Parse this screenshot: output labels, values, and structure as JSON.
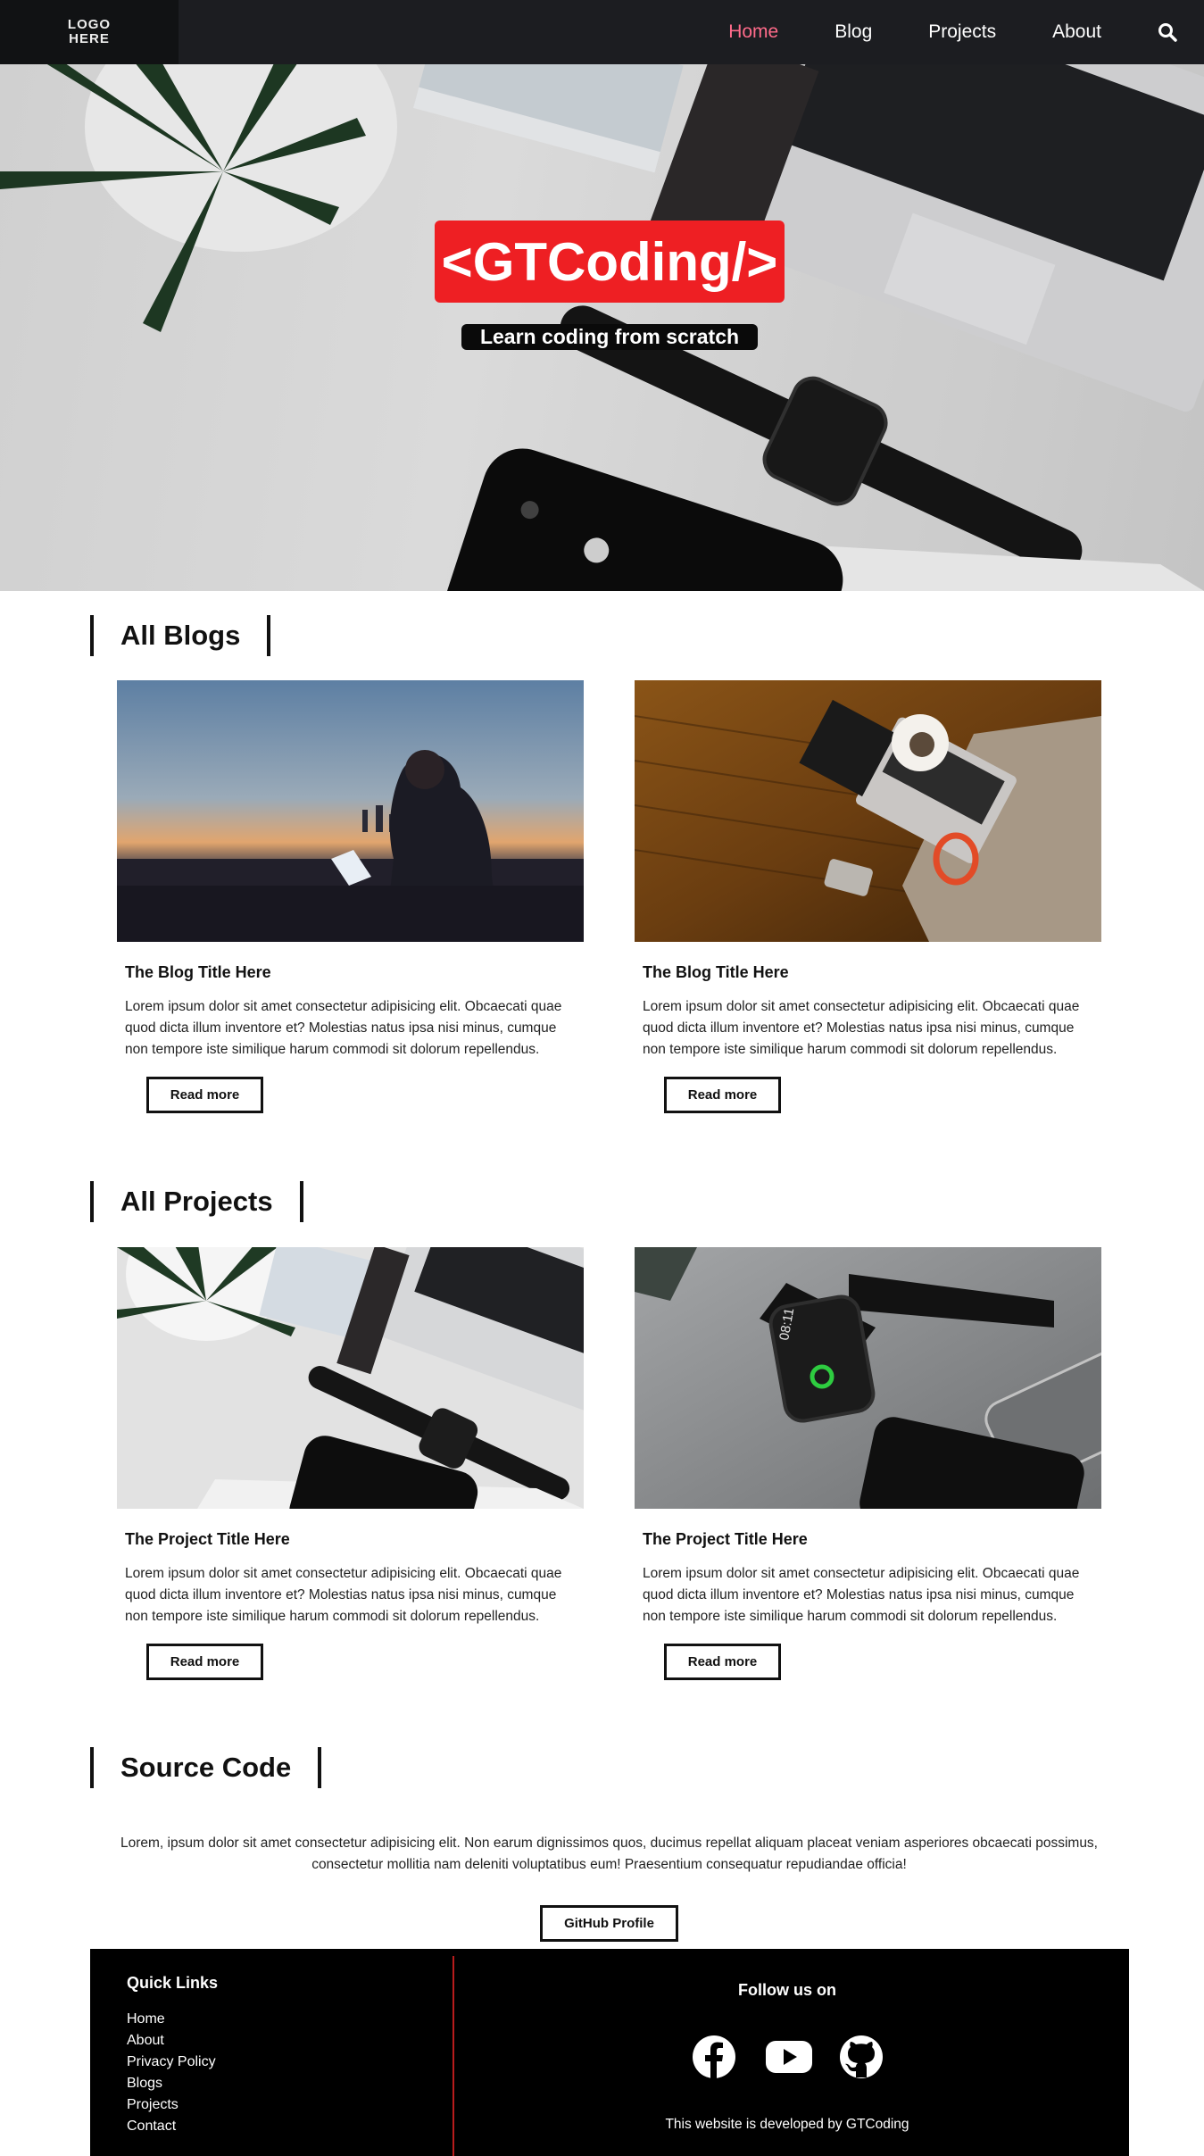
{
  "nav": {
    "logo_line1": "LOGO",
    "logo_line2": "HERE",
    "links": [
      "Home",
      "Blog",
      "Projects",
      "About"
    ],
    "active": "Home"
  },
  "hero": {
    "title": "<GTCoding/>",
    "subtitle": "Learn coding from scratch"
  },
  "blogs": {
    "heading": "All Blogs",
    "items": [
      {
        "title": "The Blog Title Here",
        "text": "Lorem ipsum dolor sit amet consectetur adipisicing elit. Obcaecati quae quod dicta illum inventore et? Molestias natus ipsa nisi minus, cumque non tempore iste similique harum commodi sit dolorum repellendus.",
        "button": "Read more"
      },
      {
        "title": "The Blog Title Here",
        "text": "Lorem ipsum dolor sit amet consectetur adipisicing elit. Obcaecati quae quod dicta illum inventore et? Molestias natus ipsa nisi minus, cumque non tempore iste similique harum commodi sit dolorum repellendus.",
        "button": "Read more"
      }
    ]
  },
  "projects": {
    "heading": "All Projects",
    "items": [
      {
        "title": "The Project Title Here",
        "text": "Lorem ipsum dolor sit amet consectetur adipisicing elit. Obcaecati quae quod dicta illum inventore et? Molestias natus ipsa nisi minus, cumque non tempore iste similique harum commodi sit dolorum repellendus.",
        "button": "Read more"
      },
      {
        "title": "The Project Title Here",
        "text": "Lorem ipsum dolor sit amet consectetur adipisicing elit. Obcaecati quae quod dicta illum inventore et? Molestias natus ipsa nisi minus, cumque non tempore iste similique harum commodi sit dolorum repellendus.",
        "button": "Read more"
      }
    ]
  },
  "source": {
    "heading": "Source Code",
    "text": "Lorem, ipsum dolor sit amet consectetur adipisicing elit. Non earum dignissimos quos, ducimus repellat aliquam placeat veniam asperiores obcaecati possimus, consectetur mollitia nam deleniti voluptatibus eum! Praesentium consequatur repudiandae officia!",
    "button": "GitHub Profile"
  },
  "footer": {
    "quick_links_title": "Quick Links",
    "quick_links": [
      "Home",
      "About",
      "Privacy Policy",
      "Blogs",
      "Projects",
      "Contact"
    ],
    "follow_title": "Follow us on",
    "social_icons": [
      "facebook-icon",
      "youtube-icon",
      "github-icon"
    ],
    "developer_text": "This website is developed by GTCoding"
  },
  "colors": {
    "accent_red": "#ee1f23",
    "nav_active": "#ff6b8a",
    "nav_bg": "#1c1d21",
    "divider": "#b71c1c"
  }
}
